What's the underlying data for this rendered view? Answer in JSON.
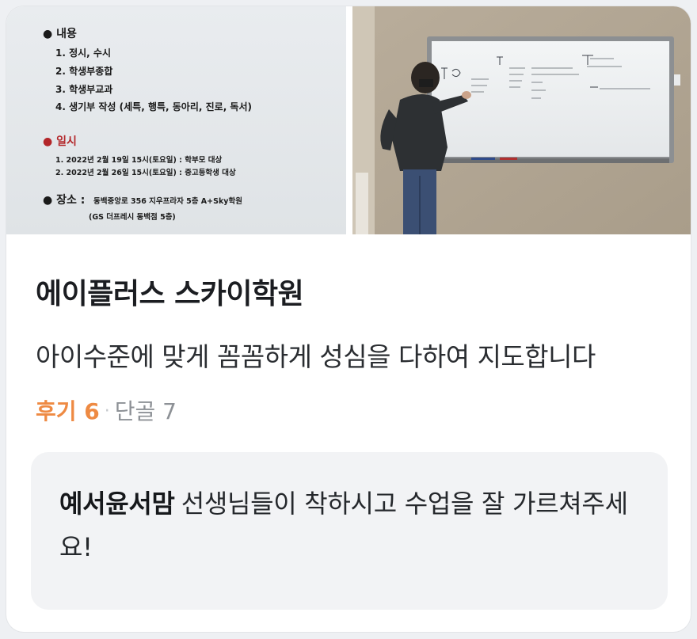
{
  "photos": {
    "left_notice": {
      "section_contents": "● 내용",
      "items": [
        "1. 정시, 수시",
        "2. 학생부종합",
        "3. 학생부교과",
        "4. 생기부 작성 (세특, 행특, 동아리, 진로, 독서)"
      ],
      "section_schedule": "● 일시",
      "schedule": [
        "1.  2022년  2월  19일  15시(토요일) : 학부모 대상",
        "2.  2022년  2월  26일  15시(토요일) : 중고등학생 대상"
      ],
      "place_label": "● 장소 :",
      "place_line1": "동백중앙로 356 지우프라자 5층 A+Sky학원",
      "place_line2": "(GS 더프레시 동백점 5층)"
    }
  },
  "place": {
    "name": "에이플러스 스카이학원",
    "description": "아이수준에 맞게 꼼꼼하게 성심을 다하여 지도합니다",
    "reviews_label": "후기 6",
    "separator": "·",
    "regulars_label": "단골 7"
  },
  "review": {
    "author": "예서윤서맘",
    "text": "선생님들이 착하시고 수업을 잘 가르쳐주세요!"
  },
  "colors": {
    "accent": "#ee8a43",
    "muted": "#8d9196",
    "review_bg": "#f2f3f5"
  }
}
